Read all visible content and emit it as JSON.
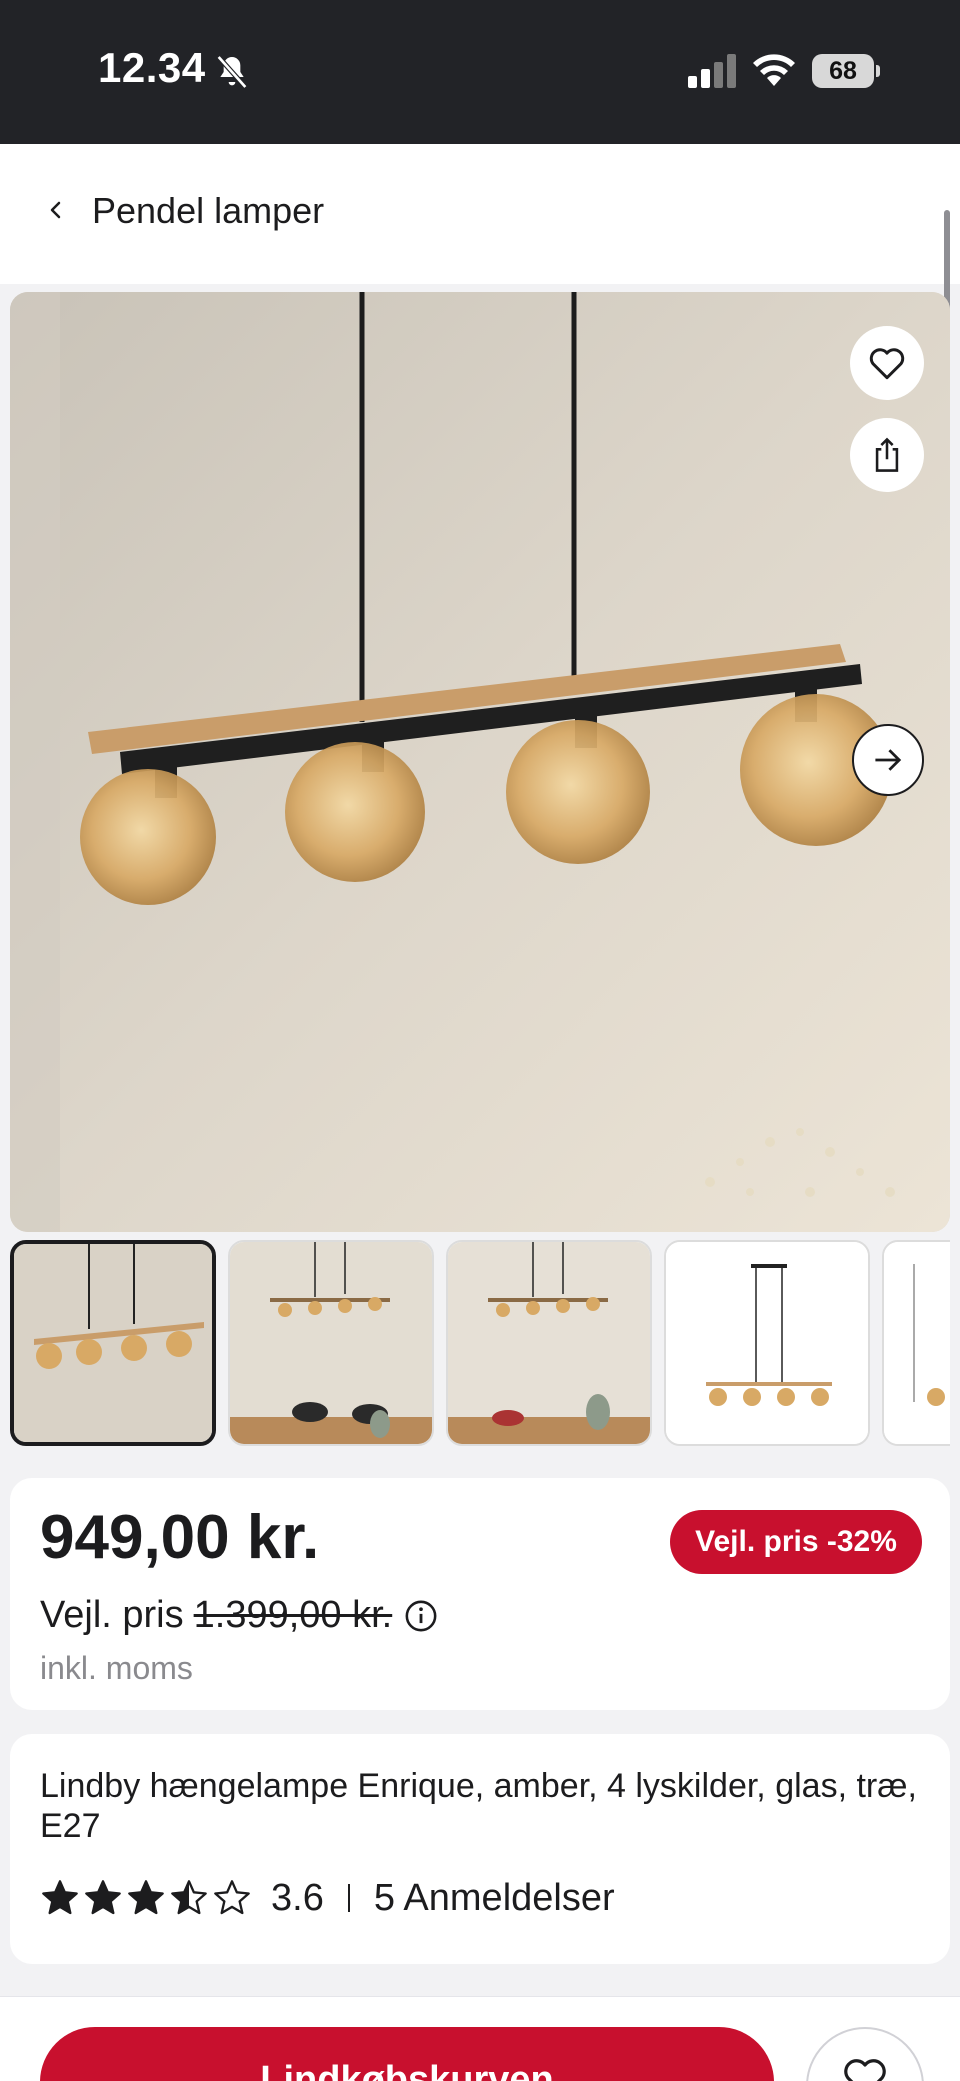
{
  "status_bar": {
    "time": "12.34",
    "battery": "68",
    "icons": [
      "bell-slash-icon",
      "cellular-signal-icon",
      "wifi-icon",
      "battery-icon"
    ]
  },
  "header": {
    "back_icon": "chevron-left-icon",
    "title": "Pendel lamper"
  },
  "gallery": {
    "active_index": 0,
    "thumbnail_count": 5,
    "actions": [
      "heart-icon",
      "share-icon",
      "arrow-right-icon"
    ]
  },
  "price": {
    "current": "949,00 kr.",
    "rrp_label": "Vejl. pris",
    "rrp_value": "1.399,00 kr.",
    "vat_note": "inkl. moms",
    "discount_badge": "Vejl. pris -32%"
  },
  "product": {
    "title": "Lindby hængelampe Enrique, amber, 4 lyskilder, glas, træ, E27",
    "rating": "3.6",
    "rating_stars": 3.5,
    "rating_max": 5,
    "reviews": "5 Anmeldelser"
  },
  "actions": {
    "add_to_cart": "Lindkøbskurven"
  },
  "colors": {
    "accent_red": "#c8102e",
    "status_bar_bg": "#222327",
    "page_bg": "#f2f2f4"
  }
}
